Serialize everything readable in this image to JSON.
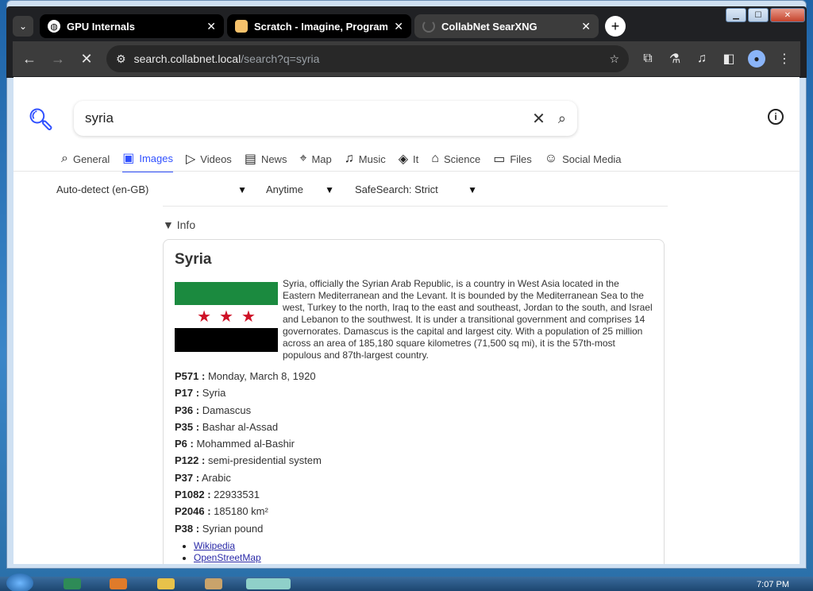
{
  "browser": {
    "tabs": [
      {
        "title": "GPU Internals",
        "active": false
      },
      {
        "title": "Scratch - Imagine, Program, Sh",
        "active": false
      },
      {
        "title": "CollabNet SearXNG",
        "active": true
      }
    ],
    "url_host": "search.collabnet.local",
    "url_path": "/search?q=syria"
  },
  "search": {
    "query": "syria"
  },
  "categories": [
    {
      "label": "General",
      "icon": "search-icon",
      "active": false
    },
    {
      "label": "Images",
      "icon": "image-icon",
      "active": true
    },
    {
      "label": "Videos",
      "icon": "play-icon",
      "active": false
    },
    {
      "label": "News",
      "icon": "newspaper-icon",
      "active": false
    },
    {
      "label": "Map",
      "icon": "map-pin-icon",
      "active": false
    },
    {
      "label": "Music",
      "icon": "music-icon",
      "active": false
    },
    {
      "label": "It",
      "icon": "layers-icon",
      "active": false
    },
    {
      "label": "Science",
      "icon": "graduation-icon",
      "active": false
    },
    {
      "label": "Files",
      "icon": "files-icon",
      "active": false
    },
    {
      "label": "Social Media",
      "icon": "people-icon",
      "active": false
    }
  ],
  "filters": {
    "language": "Auto-detect (en-GB)",
    "time": "Anytime",
    "safesearch": "SafeSearch: Strict"
  },
  "info_toggle": "Info",
  "infobox": {
    "title": "Syria",
    "description": "Syria, officially the Syrian Arab Republic, is a country in West Asia located in the Eastern Mediterranean and the Levant. It is bounded by the Mediterranean Sea to the west, Turkey to the north, Iraq to the east and southeast, Jordan to the south, and Israel and Lebanon to the southwest. It is under a transitional government and comprises 14 governorates. Damascus is the capital and largest city. With a population of 25 million across an area of 185,180 square kilometres (71,500 sq mi), it is the 57th-most populous and 87th-largest country.",
    "properties": [
      {
        "key": "P571 :",
        "value": "Monday, March 8, 1920"
      },
      {
        "key": "P17 :",
        "value": "Syria"
      },
      {
        "key": "P36 :",
        "value": "Damascus"
      },
      {
        "key": "P35 :",
        "value": "Bashar al-Assad"
      },
      {
        "key": "P6 :",
        "value": "Mohammed al-Bashir"
      },
      {
        "key": "P122 :",
        "value": "semi-presidential system"
      },
      {
        "key": "P37 :",
        "value": "Arabic"
      },
      {
        "key": "P1082 :",
        "value": "22933531"
      },
      {
        "key": "P2046 :",
        "value": "185180 km²"
      },
      {
        "key": "P38 :",
        "value": "Syrian pound"
      }
    ],
    "links": [
      "Wikipedia",
      "OpenStreetMap"
    ]
  },
  "taskbar": {
    "time": "7:07 PM"
  }
}
